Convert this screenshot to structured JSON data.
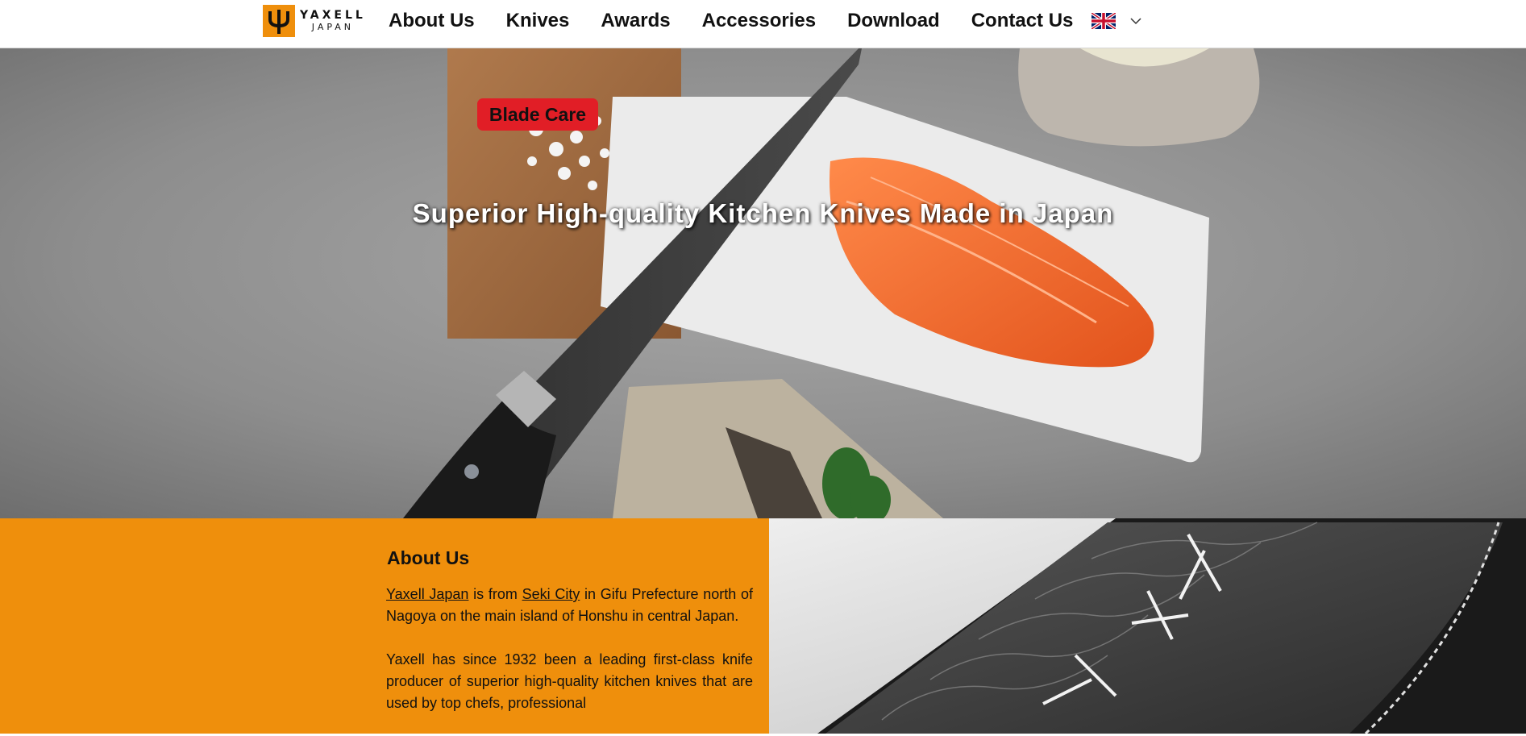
{
  "brand": {
    "name": "YAXELL",
    "sub": "JAPAN",
    "logo_color": "#ef8f0c",
    "icon": "trident-icon"
  },
  "nav": {
    "items": [
      {
        "label": "About Us"
      },
      {
        "label": "Knives"
      },
      {
        "label": "Awards"
      },
      {
        "label": "Accessories"
      },
      {
        "label": "Download"
      },
      {
        "label": "Contact Us"
      }
    ],
    "language_icon": "uk-flag-icon",
    "language_dropdown_icon": "chevron-down-icon"
  },
  "hero": {
    "title": "Superior High-quality Kitchen Knives Made in Japan",
    "button_label": "Blade Care",
    "button_color": "#e11e26",
    "slide_count": 6,
    "active_slide": 1
  },
  "about": {
    "title": "About Us",
    "bg_color": "#ef8f0c",
    "p1": {
      "link1": "Yaxell Japan",
      "text1": " is from ",
      "link2": "Seki City",
      "text2": " in Gifu Prefecture north of Nagoya on the main island of Honshu in central Japan."
    },
    "p2": "Yaxell has since 1932 been a leading first-class knife producer of superior high-quality kitchen knives that are used by top chefs, professional"
  }
}
